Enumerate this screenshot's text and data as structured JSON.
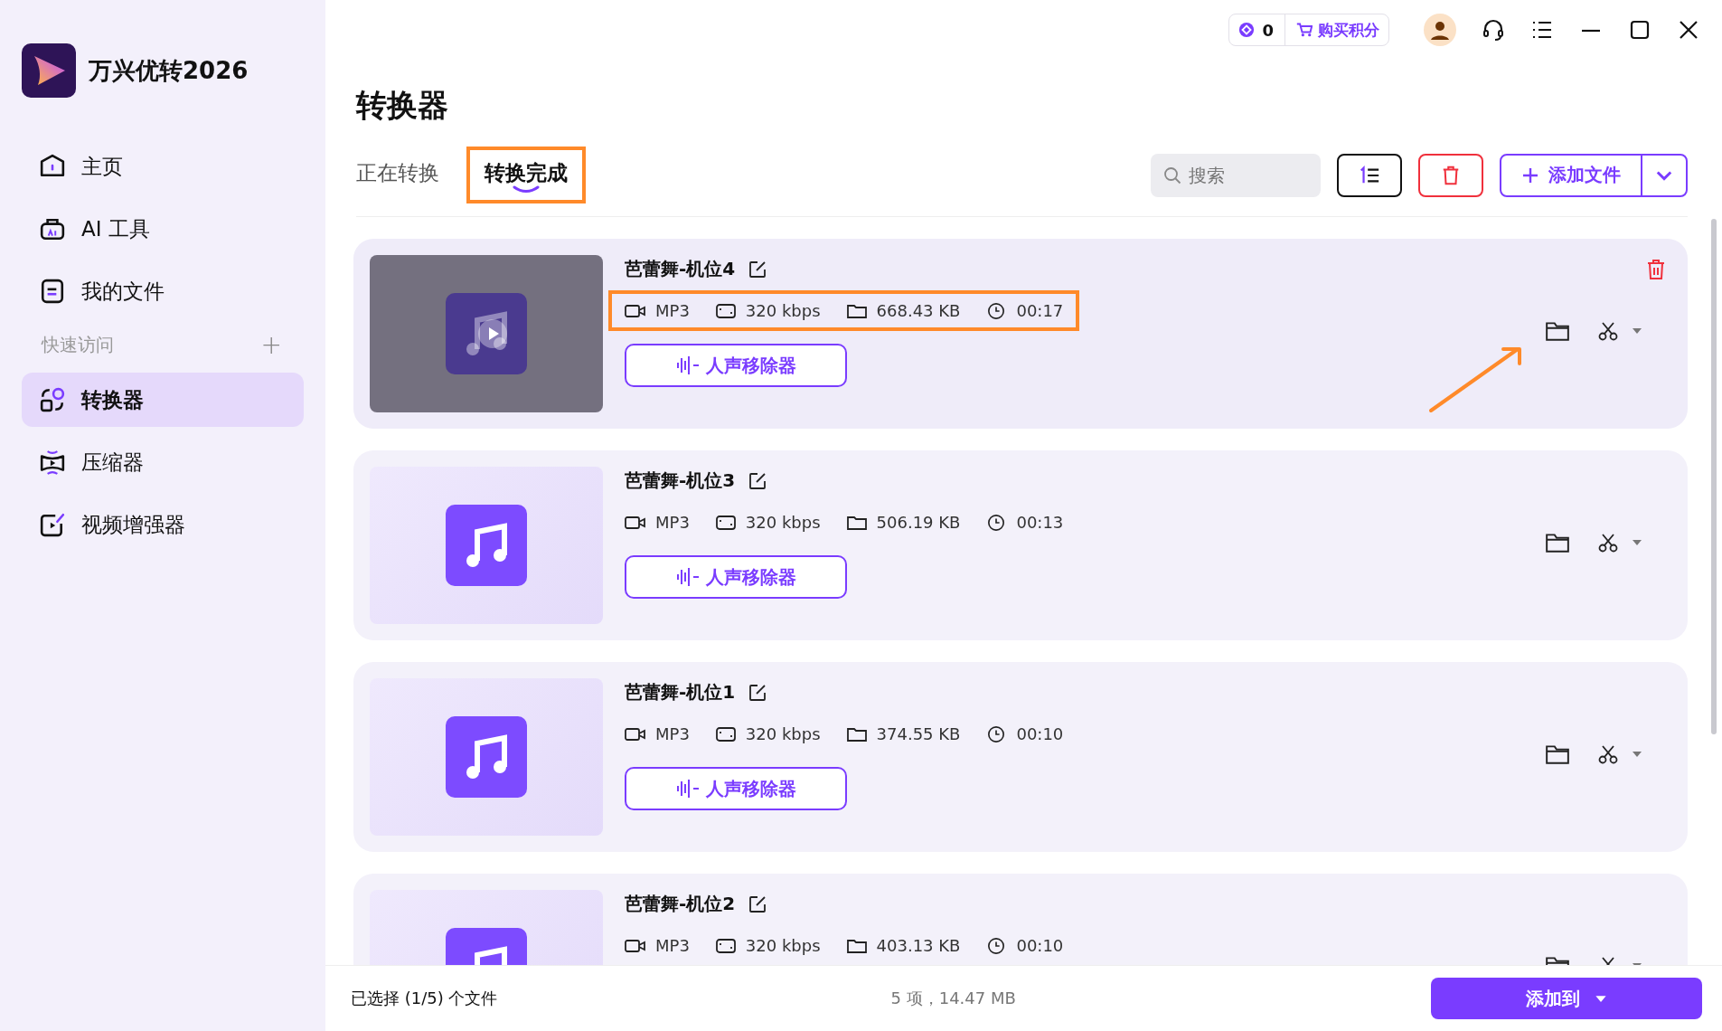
{
  "app": {
    "name": "万兴优转2026"
  },
  "sidebar": {
    "items": [
      {
        "label": "主页",
        "selected": false
      },
      {
        "label": "AI 工具",
        "selected": false
      },
      {
        "label": "我的文件",
        "selected": false
      }
    ],
    "section": {
      "label": "快速访问",
      "add": "+"
    },
    "quick_items": [
      {
        "label": "转换器",
        "selected": true
      },
      {
        "label": "压缩器",
        "selected": false
      },
      {
        "label": "视频增强器",
        "selected": false
      }
    ]
  },
  "top_bar": {
    "points": "0",
    "buy": "购买积分"
  },
  "page": {
    "title": "转换器"
  },
  "tabs": [
    {
      "label": "正在转换",
      "selected": false,
      "annotated": false
    },
    {
      "label": "转换完成",
      "selected": true,
      "annotated": true
    }
  ],
  "search": {
    "placeholder": "搜索"
  },
  "add_button": "添加文件",
  "files": [
    {
      "name": "芭蕾舞-机位4",
      "format": "MP3",
      "bitrate": "320 kbps",
      "size": "668.43 KB",
      "duration": "00:17",
      "action": "人声移除器",
      "selected": true,
      "info_annotated": true,
      "arrow": true
    },
    {
      "name": "芭蕾舞-机位3",
      "format": "MP3",
      "bitrate": "320 kbps",
      "size": "506.19 KB",
      "duration": "00:13",
      "action": "人声移除器",
      "selected": false,
      "info_annotated": false,
      "arrow": false
    },
    {
      "name": "芭蕾舞-机位1",
      "format": "MP3",
      "bitrate": "320 kbps",
      "size": "374.55 KB",
      "duration": "00:10",
      "action": "人声移除器",
      "selected": false,
      "info_annotated": false,
      "arrow": false
    },
    {
      "name": "芭蕾舞-机位2",
      "format": "MP3",
      "bitrate": "320 kbps",
      "size": "403.13 KB",
      "duration": "00:10",
      "selected": false,
      "info_annotated": false,
      "arrow": false
    }
  ],
  "status_bar": {
    "selection": "已选择 (1/5) 个文件",
    "summary": "5 项，14.47 MB",
    "button": "添加到"
  }
}
